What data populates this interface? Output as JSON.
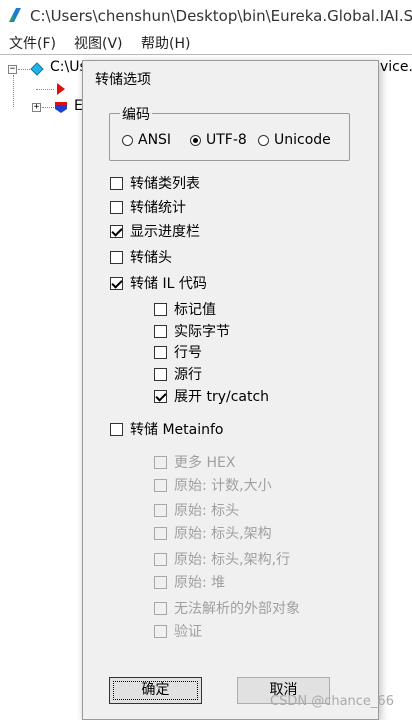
{
  "window": {
    "title": "C:\\Users\\chenshun\\Desktop\\bin\\Eureka.Global.IAI.Se",
    "menu": [
      "文件(F)",
      "视图(V)",
      "帮助(H)"
    ]
  },
  "tree": {
    "root_label": "C:\\Us",
    "root_suffix": "vice.c",
    "child2_label": "E",
    "expander_minus": "−",
    "expander_plus": "+"
  },
  "dialog": {
    "title": "转储选项",
    "encoding": {
      "label": "编码",
      "options": [
        "ANSI",
        "UTF-8",
        "Unicode"
      ],
      "selected": "UTF-8"
    },
    "options": [
      {
        "label": "转储类列表",
        "checked": false,
        "enabled": true
      },
      {
        "label": "转储统计",
        "checked": false,
        "enabled": true
      },
      {
        "label": "显示进度栏",
        "checked": true,
        "enabled": true
      },
      {
        "label": "转储头",
        "checked": false,
        "enabled": true
      },
      {
        "label": "转储 IL 代码",
        "checked": true,
        "enabled": true
      }
    ],
    "il_sub_options": [
      {
        "label": "标记值",
        "checked": false,
        "enabled": true
      },
      {
        "label": "实际字节",
        "checked": false,
        "enabled": true
      },
      {
        "label": "行号",
        "checked": false,
        "enabled": true
      },
      {
        "label": "源行",
        "checked": false,
        "enabled": true
      },
      {
        "label": "展开 try/catch",
        "checked": true,
        "enabled": true
      }
    ],
    "metainfo": {
      "label": "转储 Metainfo",
      "checked": false,
      "enabled": true
    },
    "meta_sub_options": [
      {
        "label": "更多 HEX",
        "checked": false,
        "enabled": false
      },
      {
        "label": "原始: 计数,大小",
        "checked": false,
        "enabled": false
      },
      {
        "label": "原始: 标头",
        "checked": false,
        "enabled": false
      },
      {
        "label": "原始: 标头,架构",
        "checked": false,
        "enabled": false
      },
      {
        "label": "原始: 标头,架构,行",
        "checked": false,
        "enabled": false
      },
      {
        "label": "原始: 堆",
        "checked": false,
        "enabled": false
      },
      {
        "label": "无法解析的外部对象",
        "checked": false,
        "enabled": false
      },
      {
        "label": "验证",
        "checked": false,
        "enabled": false
      }
    ],
    "ok_label": "确定",
    "cancel_label": "取消"
  },
  "watermark": "CSDN @chance_66",
  "colors": {
    "dialog_bg": "#f0f0f0",
    "disabled_text": "#a0a0a0"
  }
}
